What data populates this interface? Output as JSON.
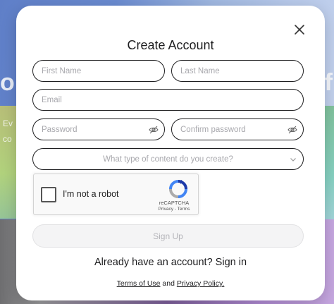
{
  "background": {
    "left_big": "o",
    "right_big": "f",
    "left_small_1": "Ev",
    "left_small_2": "co"
  },
  "modal": {
    "title": "Create Account",
    "close_icon": "close-icon",
    "first_name": {
      "placeholder": "First Name",
      "value": ""
    },
    "last_name": {
      "placeholder": "Last Name",
      "value": ""
    },
    "email": {
      "placeholder": "Email",
      "value": ""
    },
    "password": {
      "placeholder": "Password",
      "value": "",
      "icon": "eye-slash-icon"
    },
    "confirm_password": {
      "placeholder": "Confirm password",
      "value": "",
      "icon": "eye-slash-icon"
    },
    "content_type": {
      "selected": "What type of content do you create?",
      "icon": "chevron-down-icon"
    },
    "captcha": {
      "label": "I'm not a robot",
      "brand": "reCAPTCHA",
      "privacy": "Privacy",
      "separator": " - ",
      "terms": "Terms",
      "checked": false
    },
    "signup_label": "Sign Up",
    "already_text": "Already have an account? ",
    "signin_label": "Sign in",
    "legal": {
      "terms": "Terms of Use",
      "and": " and ",
      "privacy": "Privacy Policy."
    }
  },
  "colors": {
    "border": "#1d1d1f",
    "placeholder": "#a8a8ad",
    "signup_bg": "#f4f4f5"
  }
}
